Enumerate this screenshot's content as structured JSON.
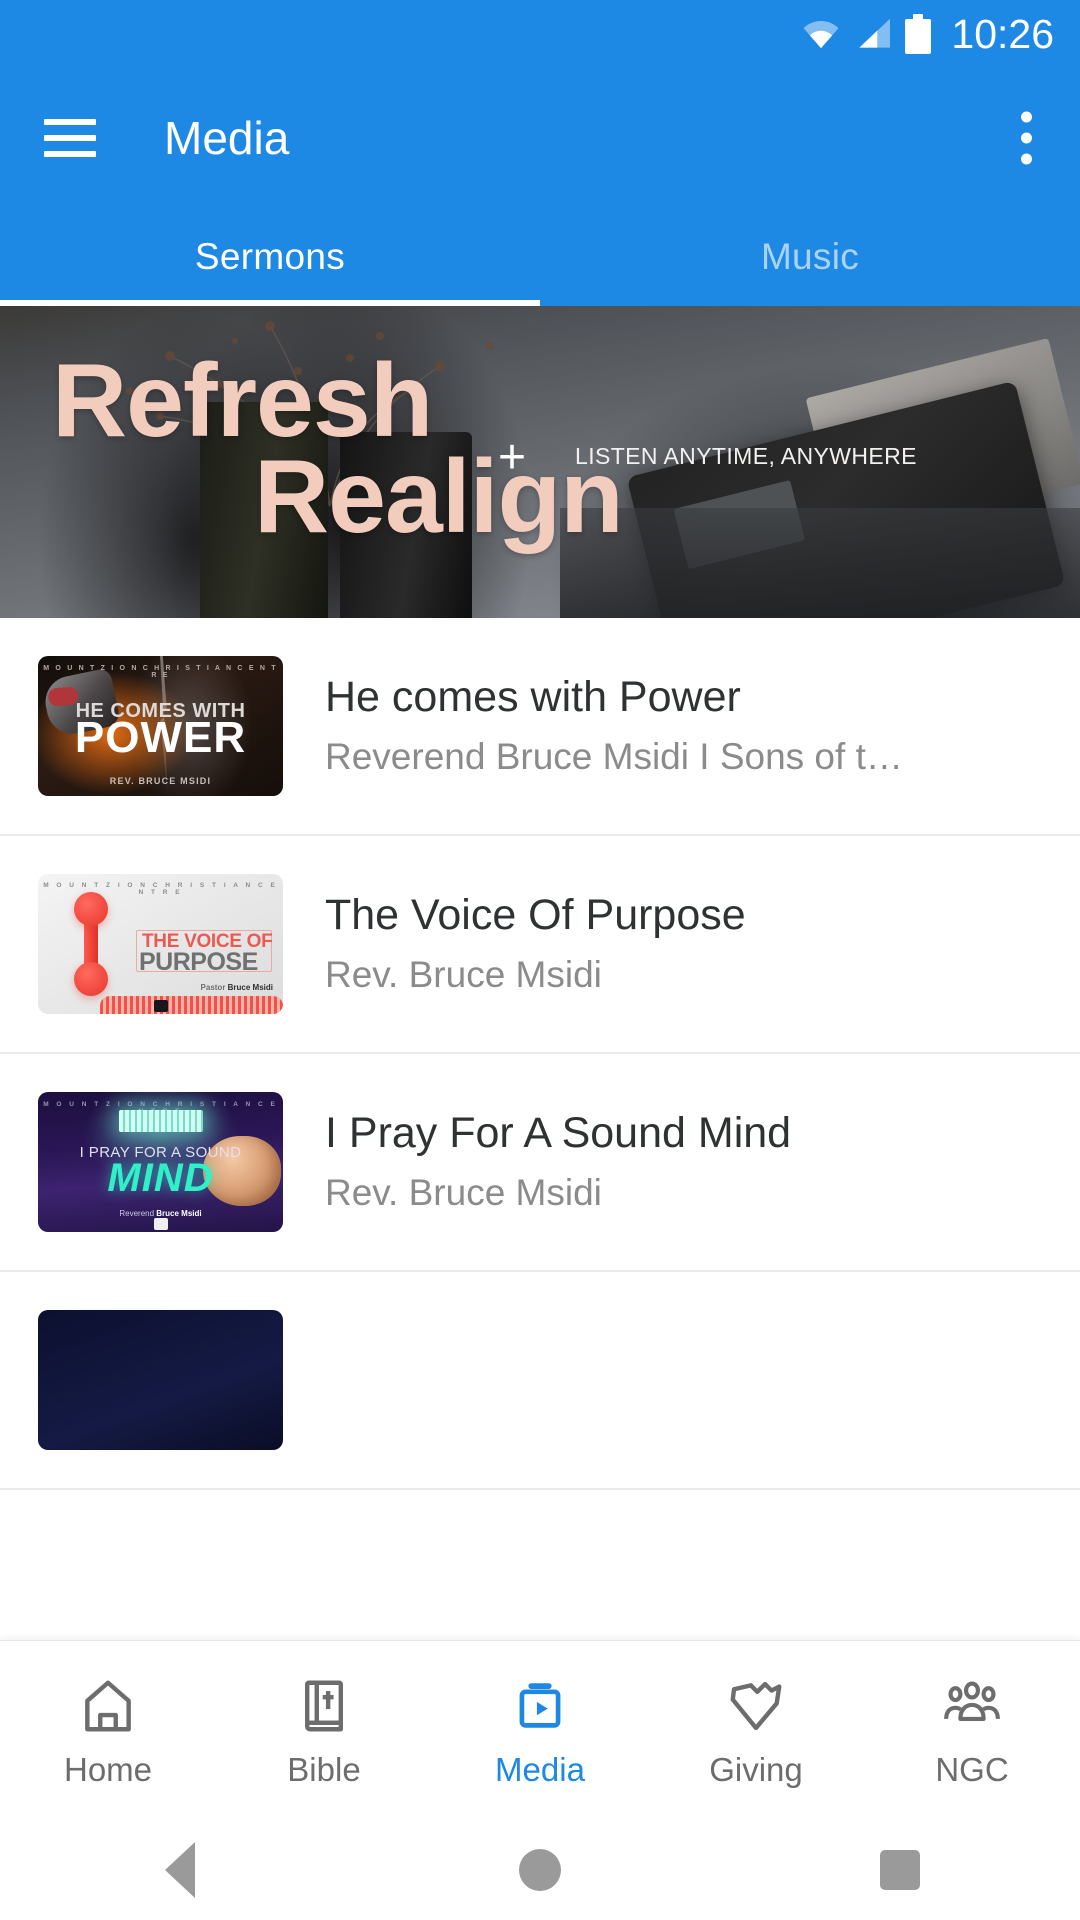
{
  "status_bar": {
    "time": "10:26",
    "icons": [
      "wifi-icon",
      "cellular-signal-icon",
      "battery-icon"
    ]
  },
  "app_bar": {
    "title": "Media",
    "menu_icon": "hamburger-menu-icon",
    "overflow_icon": "more-vertical-icon"
  },
  "tabs": {
    "items": [
      {
        "label": "Sermons",
        "active": true
      },
      {
        "label": "Music",
        "active": false
      }
    ]
  },
  "banner": {
    "title_line1": "Refresh",
    "title_line2": "Realign",
    "plus": "+",
    "subtitle": "LISTEN ANYTIME, ANYWHERE",
    "title_color": "#f2cdbe"
  },
  "sermons": [
    {
      "title": "He comes with Power",
      "subtitle": "Reverend Bruce Msidi I Sons of t…",
      "thumbnail": {
        "header": "M O U N T   Z I O N   C H R I S T I A N   C E N T R E",
        "line1": "HE COMES WITH",
        "line2": "POWER",
        "line3": "REV. BRUCE MSIDI"
      }
    },
    {
      "title": "The Voice Of Purpose",
      "subtitle": "Rev. Bruce Msidi",
      "thumbnail": {
        "header": "M O U N T   Z I O N   C H R I S T I A N   C E N T R E",
        "line1": "THE VOICE OF",
        "line2": "PURPOSE",
        "line3_prefix": "Pastor ",
        "line3_name": "Bruce Msidi"
      }
    },
    {
      "title": "I Pray For A Sound Mind",
      "subtitle": "Rev. Bruce Msidi",
      "thumbnail": {
        "header": "M O U N T   Z I O N   C H R I S T I A N   C E N T R E",
        "line1": "I PRAY FOR  A SOUND",
        "line2": "MIND",
        "line3_prefix": "Reverend ",
        "line3_name": "Bruce Msidi"
      }
    }
  ],
  "bottom_nav": {
    "items": [
      {
        "label": "Home",
        "icon": "home-icon",
        "active": false
      },
      {
        "label": "Bible",
        "icon": "bible-icon",
        "active": false
      },
      {
        "label": "Media",
        "icon": "media-icon",
        "active": true
      },
      {
        "label": "Giving",
        "icon": "giving-icon",
        "active": false
      },
      {
        "label": "NGC",
        "icon": "group-icon",
        "active": false
      }
    ],
    "active_color": "#1e88e5",
    "inactive_color": "#6d6d6d"
  },
  "system_nav": {
    "back": "back-triangle-icon",
    "home": "home-circle-icon",
    "recents": "recents-square-icon"
  },
  "theme": {
    "primary": "#1e88e5",
    "background": "#ffffff"
  }
}
